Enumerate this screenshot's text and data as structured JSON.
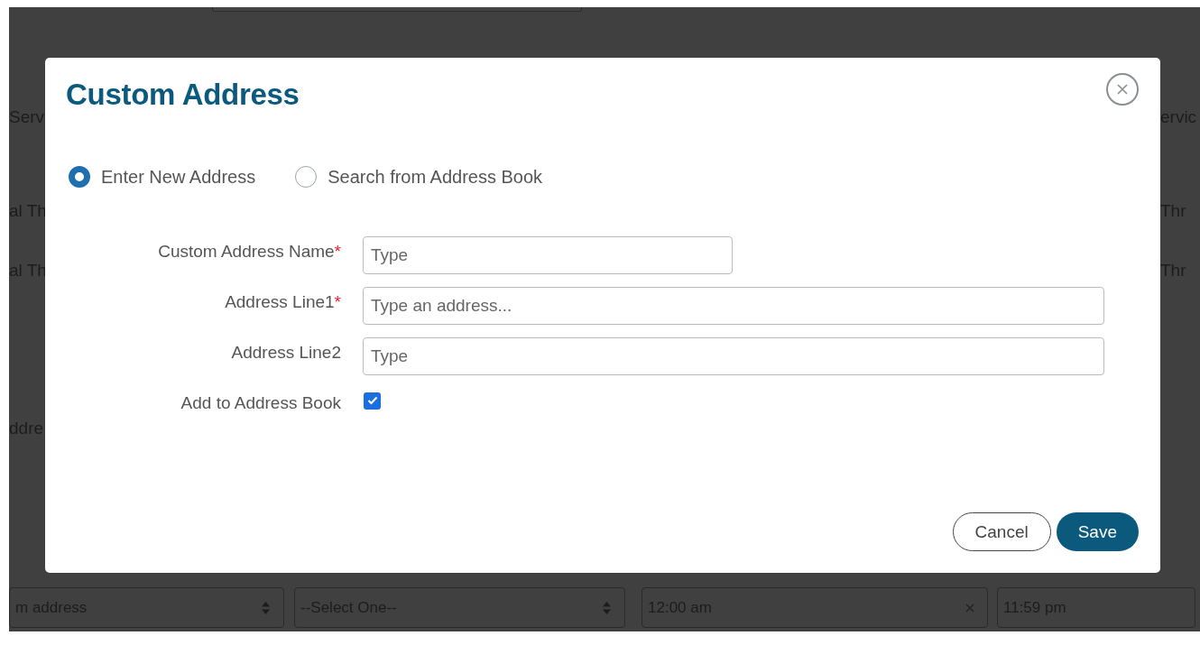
{
  "background": {
    "left_texts": [
      "Serv",
      "al Th",
      "al Th",
      "ddre"
    ],
    "right_texts": [
      "ervic",
      "Thr",
      "Thr"
    ],
    "filters": [
      {
        "kind": "select",
        "value": "m address"
      },
      {
        "kind": "select",
        "value": "--Select One--"
      },
      {
        "kind": "clearable",
        "value": "12:00 am"
      },
      {
        "kind": "text",
        "value": "11:59 pm"
      }
    ]
  },
  "dialog": {
    "title": "Custom Address",
    "mode_options": [
      {
        "label": "Enter New Address",
        "selected": true
      },
      {
        "label": "Search from Address Book",
        "selected": false
      }
    ],
    "fields": [
      {
        "label": "Custom Address Name",
        "required_mark": "*",
        "placeholder": "Type"
      },
      {
        "label": "Address Line1",
        "required_mark": "*",
        "placeholder": "Type an address..."
      },
      {
        "label": "Address Line2",
        "placeholder": "Type"
      }
    ],
    "add_to_address_book": {
      "label": "Add to Address Book",
      "checked": true
    },
    "buttons": [
      {
        "label": "Cancel",
        "kind": "secondary"
      },
      {
        "label": "Save",
        "kind": "primary"
      }
    ]
  }
}
